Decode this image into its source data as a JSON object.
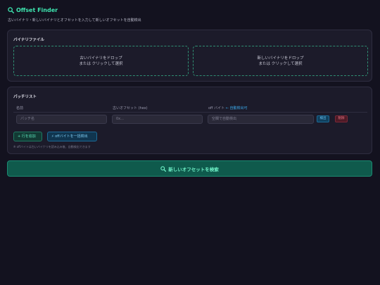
{
  "header": {
    "title": "Offset Finder",
    "subtitle": "古いバイナリ・新しいバイナリとオフセットを入力して新しいオフセットを自動検出",
    "icon": "magnifier-icon"
  },
  "binary_files": {
    "title": "バイナリファイル",
    "old_drop": {
      "line1": "古いバイナリをドロップ",
      "line2": "または クリックして選択"
    },
    "new_drop": {
      "line1": "新しいバイナリをドロップ",
      "line2": "または クリックして選択"
    }
  },
  "patch_list": {
    "title": "パッチリスト",
    "columns": {
      "name": "名前",
      "old_offset": "古いオフセット (hex)",
      "off_bytes": "off バイト",
      "off_bytes_link": "← 自動検出可"
    },
    "rows": [
      {
        "name_placeholder": "パッチ名",
        "old_offset_placeholder": "0x...",
        "off_bytes_placeholder": "空欄で自動検出",
        "detect_label": "検出",
        "delete_label": "削除"
      }
    ],
    "add_row_label": "+ 行を追加",
    "auto_detect_label": "⚡ offバイトを一括検出",
    "hint": "※ offバイトは古いバイナリを読み込み後、自動検出できます"
  },
  "search_button": {
    "label": "新しいオフセットを検索",
    "icon": "magnifier-icon"
  },
  "colors": {
    "background": "#13121f",
    "accent": "#3ee6b0",
    "panel": "#1c1b2a",
    "link": "#3aa7e8",
    "danger": "#f07b8a"
  }
}
